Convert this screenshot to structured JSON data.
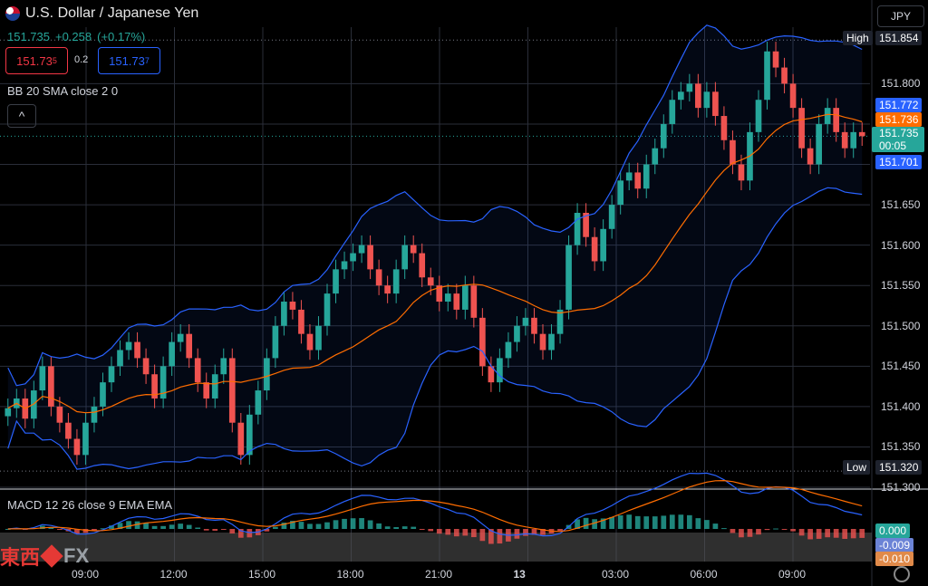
{
  "header": {
    "symbol": "U.S. Dollar / Japanese Yen",
    "last": "151.735",
    "change": "+0.258",
    "change_pct": "(+0.17%)",
    "bid": "151.73",
    "bid_sup": "5",
    "spread": "0.2",
    "ask": "151.73",
    "ask_sup": "7",
    "currency": "JPY",
    "collapse_glyph": "^"
  },
  "indicators": {
    "bb_label": "BB 20 SMA close 2 0",
    "macd_label": "MACD 12 26 close 9 EMA EMA"
  },
  "watermark": {
    "cn_text": "東西",
    "fx_text": "FX"
  },
  "colors": {
    "up": "#26a69a",
    "down": "#ef5350",
    "bb": "#2962ff",
    "basis": "#ff6d00",
    "grid": "#2a2e39",
    "bg": "#000000"
  },
  "chart_data": {
    "type": "candlestick",
    "x_ticks": [
      "09:00",
      "12:00",
      "15:00",
      "18:00",
      "21:00",
      "13",
      "03:00",
      "06:00",
      "09:00"
    ],
    "y_ticks": [
      "151.800",
      "151.750",
      "151.700",
      "151.650",
      "151.600",
      "151.550",
      "151.500",
      "151.450",
      "151.400",
      "151.350",
      "151.300"
    ],
    "ylim": [
      151.3,
      151.87
    ],
    "high_label": "High",
    "high_value": "151.854",
    "low_label": "Low",
    "low_value": "151.320",
    "bb_upper_value": "151.772",
    "bb_basis_value": "151.736",
    "last_value": "151.735",
    "countdown": "00:05",
    "bb_lower_value": "151.701",
    "close_series": [
      151.398,
      151.41,
      151.385,
      151.42,
      151.45,
      151.4,
      151.38,
      151.36,
      151.34,
      151.38,
      151.4,
      151.43,
      151.45,
      151.47,
      151.48,
      151.46,
      151.44,
      151.41,
      151.45,
      151.48,
      151.49,
      151.46,
      151.43,
      151.41,
      151.44,
      151.46,
      151.38,
      151.34,
      151.39,
      151.42,
      151.46,
      151.5,
      151.53,
      151.52,
      151.49,
      151.47,
      151.5,
      151.54,
      151.57,
      151.58,
      151.59,
      151.6,
      151.57,
      151.55,
      151.54,
      151.57,
      151.6,
      151.59,
      151.56,
      151.55,
      151.53,
      151.54,
      151.52,
      151.55,
      151.51,
      151.45,
      151.43,
      151.46,
      151.48,
      151.5,
      151.51,
      151.49,
      151.47,
      151.49,
      151.52,
      151.6,
      151.64,
      151.61,
      151.58,
      151.62,
      151.65,
      151.68,
      151.69,
      151.67,
      151.7,
      151.72,
      151.75,
      151.78,
      151.79,
      151.8,
      151.77,
      151.79,
      151.76,
      151.73,
      151.7,
      151.68,
      151.74,
      151.78,
      151.84,
      151.82,
      151.8,
      151.77,
      151.72,
      151.7,
      151.75,
      151.77,
      151.74,
      151.72,
      151.74,
      151.735
    ],
    "macd_ticks": [
      "0.000",
      "-0.009",
      "-0.010"
    ]
  }
}
